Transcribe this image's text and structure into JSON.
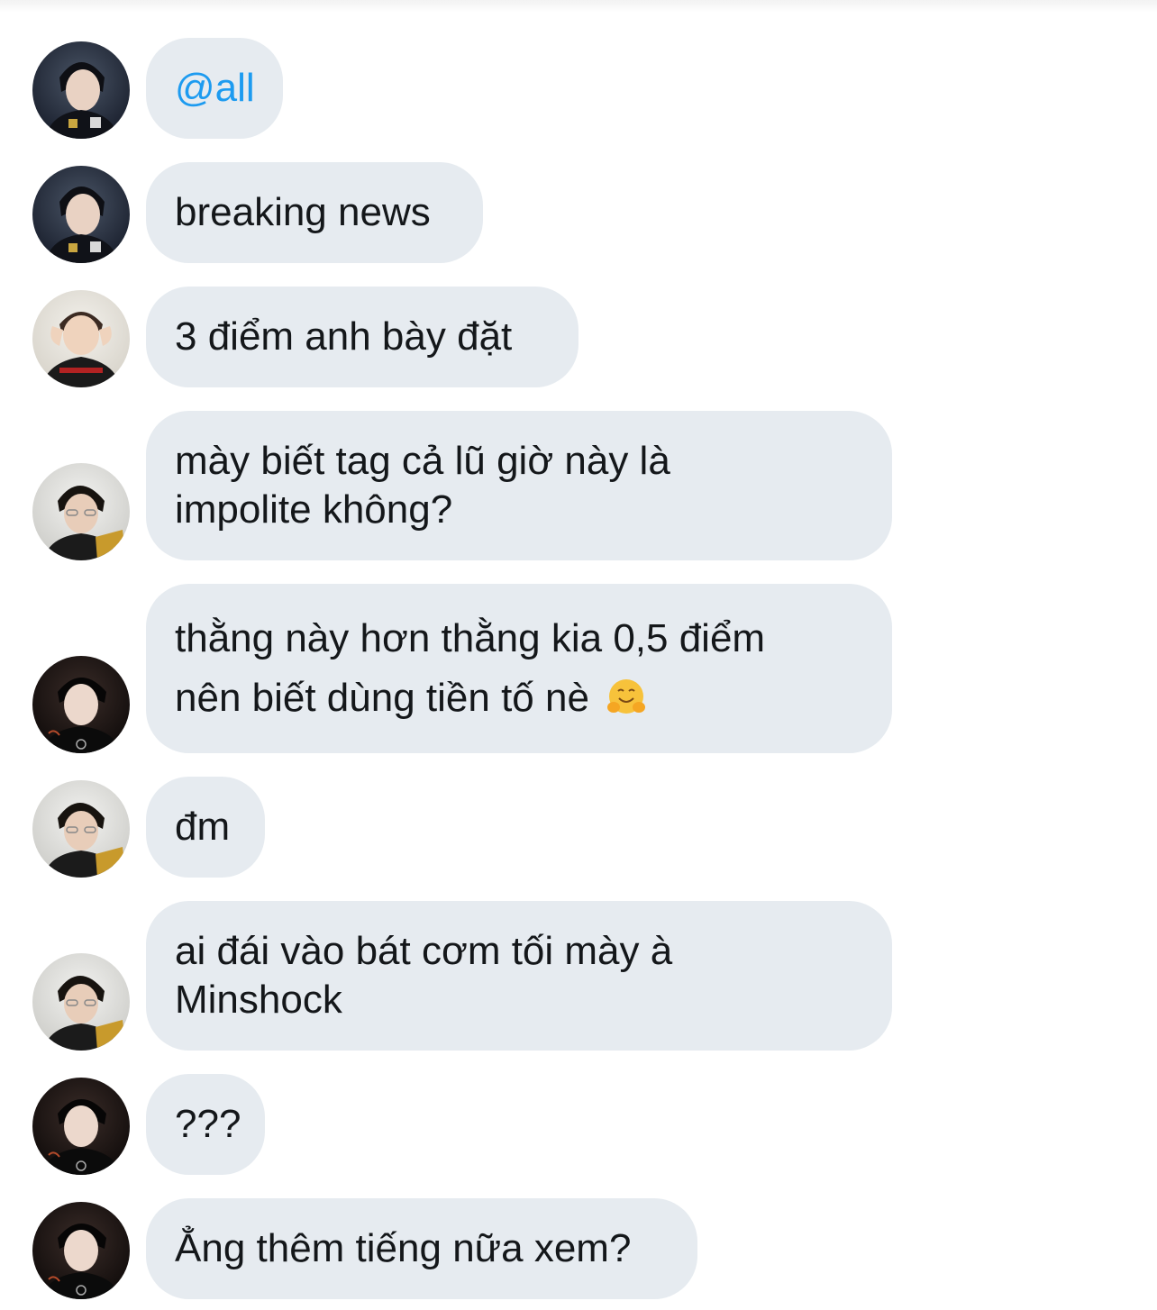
{
  "messages": [
    {
      "sender": "avatar-a",
      "text": "@all"
    },
    {
      "sender": "avatar-a",
      "text": "breaking news"
    },
    {
      "sender": "avatar-b",
      "text": "3 điểm anh bày đặt"
    },
    {
      "sender": "avatar-c",
      "line1": "mày biết tag cả lũ giờ này là",
      "line2": "impolite không?"
    },
    {
      "sender": "avatar-d",
      "line1": "thằng này hơn thằng kia 0,5 điểm",
      "line2": "nên biết dùng tiền tố nè",
      "emoji": "hugging-face-emoji"
    },
    {
      "sender": "avatar-c",
      "text": "đm"
    },
    {
      "sender": "avatar-c",
      "line1": "ai đái vào bát cơm tối mày à",
      "line2": "Minshock"
    },
    {
      "sender": "avatar-d",
      "text": "???"
    },
    {
      "sender": "avatar-d",
      "text": "Ẳng thêm tiếng nữa xem?"
    }
  ],
  "colors": {
    "bubble": "#e6ebf0",
    "text": "#14171a",
    "mention": "#1d9bf0",
    "background": "#ffffff"
  }
}
